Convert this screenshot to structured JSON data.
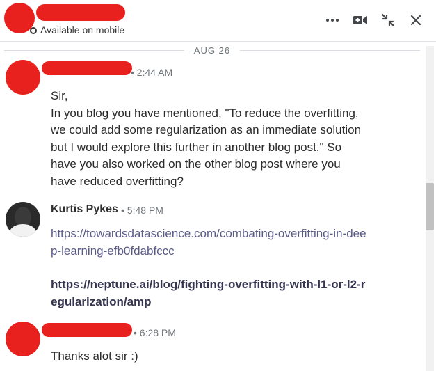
{
  "header": {
    "status": "Available on mobile",
    "actions": [
      "more-options",
      "video-call",
      "minimize",
      "close"
    ]
  },
  "date_divider": "AUG 26",
  "messages": [
    {
      "time": "• 2:44 AM",
      "text": "Sir,\nIn you blog you have mentioned, \"To reduce the overfitting, we could add some regularization as an immediate solution but I would explore this further in another blog post.\" So have you also worked on the other blog post where you have reduced overfitting?"
    },
    {
      "sender": "Kurtis Pykes",
      "time": "• 5:48 PM",
      "links": [
        "https://towardsdatascience.com/combating-overfitting-in-deep-learning-efb0fdabfccc",
        "https://neptune.ai/blog/fighting-overfitting-with-l1-or-l2-regularization/amp"
      ]
    },
    {
      "time": "• 6:28 PM",
      "text": "Thanks alot sir :)"
    }
  ],
  "colors": {
    "redaction": "#e8201e",
    "link": "#5b5b8a",
    "timestamp": "#70757a"
  }
}
